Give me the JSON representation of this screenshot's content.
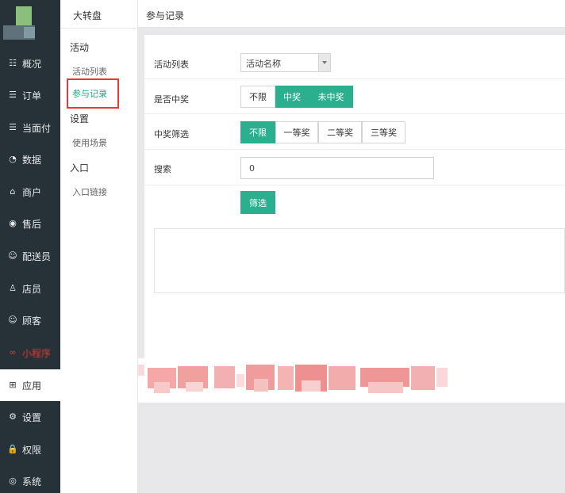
{
  "nav": {
    "items": [
      {
        "label": "概况",
        "icon": "overview-icon",
        "glyph": "☷"
      },
      {
        "label": "订单",
        "icon": "order-icon",
        "glyph": "☰"
      },
      {
        "label": "当面付",
        "icon": "face-pay-icon",
        "glyph": "☰"
      },
      {
        "label": "数据",
        "icon": "data-icon",
        "glyph": "◔"
      },
      {
        "label": "商户",
        "icon": "merchant-icon",
        "glyph": "⌂"
      },
      {
        "label": "售后",
        "icon": "after-sales-icon",
        "glyph": "◉"
      },
      {
        "label": "配送员",
        "icon": "courier-icon",
        "glyph": "☺"
      },
      {
        "label": "店员",
        "icon": "clerk-icon",
        "glyph": "♙"
      },
      {
        "label": "顾客",
        "icon": "customer-icon",
        "glyph": "☺"
      },
      {
        "label": "小程序",
        "icon": "mini-program-icon",
        "glyph": "∞"
      },
      {
        "label": "应用",
        "icon": "apps-icon",
        "glyph": "⊞"
      },
      {
        "label": "设置",
        "icon": "settings-icon",
        "glyph": "⚙"
      },
      {
        "label": "权限",
        "icon": "lock-icon",
        "glyph": "🔒"
      },
      {
        "label": "系统",
        "icon": "system-icon",
        "glyph": "◎"
      }
    ],
    "active": "应用",
    "accent_color": "#e53935",
    "background": "#263238"
  },
  "subnav": {
    "title": "大转盘",
    "groups": [
      {
        "label": "活动",
        "items": [
          "活动列表",
          "参与记录"
        ]
      },
      {
        "label": "设置",
        "items": [
          "使用场景"
        ]
      },
      {
        "label": "入口",
        "items": [
          "入口链接"
        ]
      }
    ],
    "active_item": "参与记录",
    "active_color": "#21a58c"
  },
  "main": {
    "breadcrumb": "参与记录",
    "filters": {
      "activity_label": "活动列表",
      "activity_select_value": "活动名称",
      "winning_label": "是否中奖",
      "winning_options": [
        "不限",
        "中奖",
        "未中奖"
      ],
      "prize_label": "中奖筛选",
      "prize_options": [
        "不限",
        "一等奖",
        "二等奖",
        "三等奖"
      ],
      "search_label": "搜索",
      "search_value": "0",
      "submit_label": "筛选"
    },
    "primary_color": "#2ab08f"
  }
}
